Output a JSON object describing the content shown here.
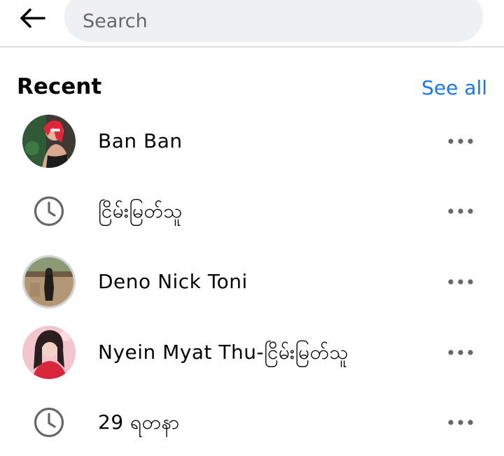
{
  "search": {
    "placeholder": "Search",
    "value": ""
  },
  "recent": {
    "title": "Recent",
    "see_all": "See all",
    "items": [
      {
        "name": "Ban Ban",
        "kind": "profile"
      },
      {
        "name": "ငြိမ်းမြတ်သူ",
        "kind": "search-history"
      },
      {
        "name": "Deno Nick Toni",
        "kind": "profile"
      },
      {
        "name": "Nyein Myat Thu-ငြိမ်းမြတ်သူ",
        "kind": "profile"
      },
      {
        "name": "29 ရတနာ",
        "kind": "search-history"
      }
    ]
  },
  "colors": {
    "accent": "#1877f2",
    "search_bg": "#eef1f4",
    "icon_gray": "#65676b",
    "divider": "#dadde1"
  }
}
